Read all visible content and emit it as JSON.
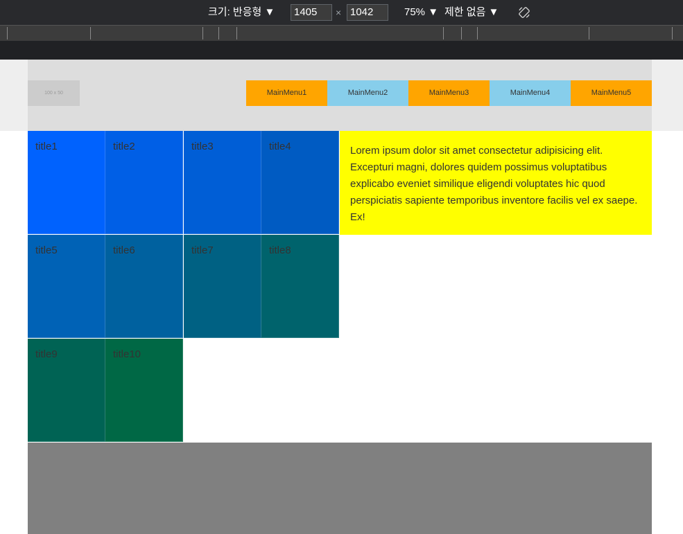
{
  "devtools": {
    "size_label": "크기: 반응형 ▼",
    "width_value": "1405",
    "height_value": "1042",
    "times": "×",
    "zoom": "75% ▼",
    "throttle": "제한 없음 ▼"
  },
  "header": {
    "logo_text": "100 x 50",
    "menu": [
      {
        "label": "MainMenu1",
        "color": "#ffa500"
      },
      {
        "label": "MainMenu2",
        "color": "#87ceeb"
      },
      {
        "label": "MainMenu3",
        "color": "#ffa500"
      },
      {
        "label": "MainMenu4",
        "color": "#87ceeb"
      },
      {
        "label": "MainMenu5",
        "color": "#ffa500"
      }
    ]
  },
  "tiles": [
    {
      "title": "title1",
      "color": "#0062fe"
    },
    {
      "title": "title2",
      "color": "#005fe6"
    },
    {
      "title": "title3",
      "color": "#005ed6"
    },
    {
      "title": "title4",
      "color": "#005bc2"
    },
    {
      "title": "title5",
      "color": "#0062b6"
    },
    {
      "title": "title6",
      "color": "#00619f"
    },
    {
      "title": "title7",
      "color": "#006183"
    },
    {
      "title": "title8",
      "color": "#00636c"
    },
    {
      "title": "title9",
      "color": "#006354"
    },
    {
      "title": "title10",
      "color": "#006845"
    }
  ],
  "content": {
    "lorem": "Lorem ipsum dolor sit amet consectetur adipisicing elit. Excepturi magni, dolores quidem possimus voluptatibus explicabo eveniet similique eligendi voluptates hic quod perspiciatis sapiente temporibus inventore facilis vel ex saepe. Ex!",
    "lorem_bg": "#ffff00"
  },
  "footer": {
    "color": "#808080"
  }
}
